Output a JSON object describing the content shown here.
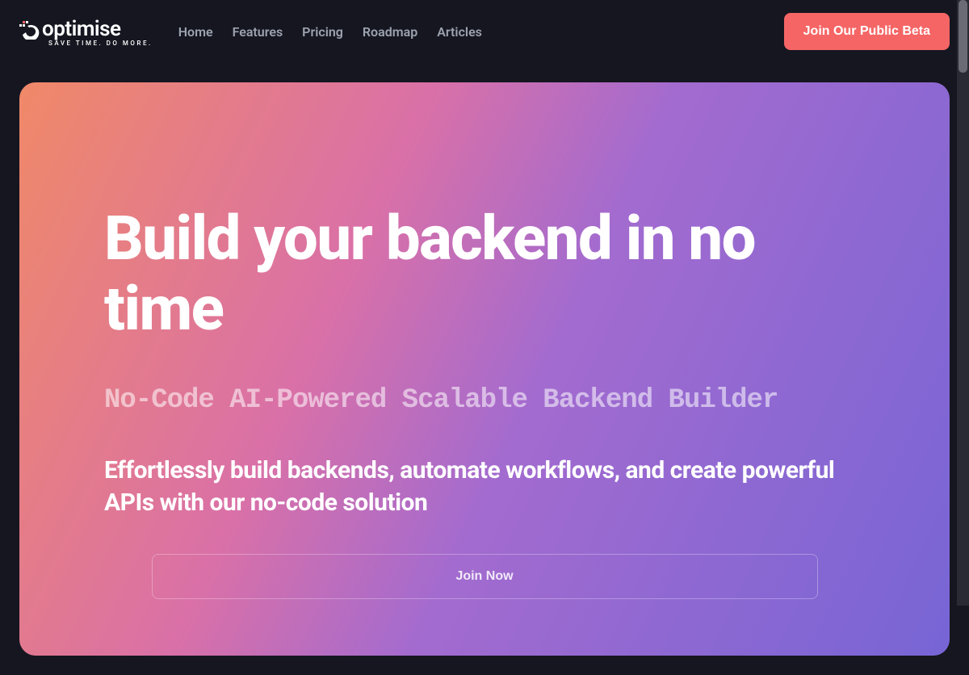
{
  "logo": {
    "text": "optimise",
    "tagline": "SAVE TIME. DO MORE."
  },
  "nav": {
    "items": [
      {
        "label": "Home"
      },
      {
        "label": "Features"
      },
      {
        "label": "Pricing"
      },
      {
        "label": "Roadmap"
      },
      {
        "label": "Articles"
      }
    ]
  },
  "header": {
    "cta_label": "Join Our Public Beta"
  },
  "hero": {
    "title": "Build your backend in no time",
    "subtitle": "No-Code AI-Powered Scalable Backend Builder",
    "description": "Effortlessly build backends, automate workflows, and create powerful APIs with our no-code solution",
    "join_label": "Join Now"
  }
}
